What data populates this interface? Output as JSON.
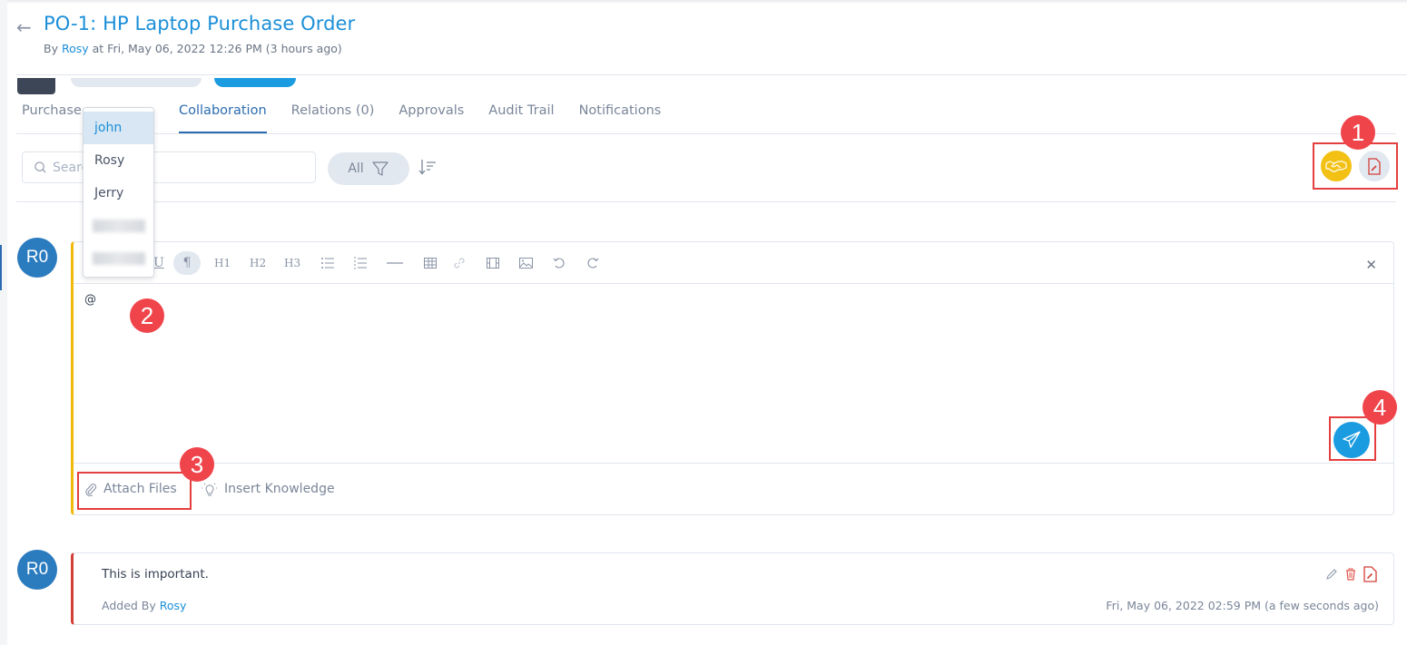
{
  "header": {
    "back_icon": "arrow-left-icon",
    "title": "PO-1: HP Laptop Purchase Order",
    "by_prefix": "By",
    "author": "Rosy",
    "created_at": "at Fri, May 06, 2022 12:26 PM (3 hours ago)"
  },
  "tabs": [
    {
      "label": "Purchase",
      "active": false
    },
    {
      "label": "Collaboration",
      "active": true
    },
    {
      "label": "Relations (0)",
      "active": false
    },
    {
      "label": "Approvals",
      "active": false
    },
    {
      "label": "Audit Trail",
      "active": false
    },
    {
      "label": "Notifications",
      "active": false
    }
  ],
  "toolbar": {
    "search_placeholder": "Search",
    "filter_label": "All",
    "filter_icon": "funnel-icon",
    "sort_icon": "sort-icon",
    "handshake_icon": "handshake-icon",
    "pdf_icon": "pdf-export-icon"
  },
  "mention_dropdown": {
    "items": [
      "john",
      "Rosy",
      "Jerry",
      "[blurred]",
      "[blurred]"
    ],
    "selected": "john"
  },
  "editor": {
    "avatar_initials": "R0",
    "toolbar_items": [
      "underline",
      "paragraph",
      "H1",
      "H2",
      "H3",
      "bullet-list",
      "numbered-list",
      "horizontal-rule",
      "table",
      "link",
      "video",
      "image",
      "undo",
      "redo"
    ],
    "h1": "H1",
    "h2": "H2",
    "h3": "H3",
    "content": "@",
    "attach_label": "Attach Files",
    "insert_knowledge_label": "Insert Knowledge",
    "accent_color": "#f2b90d"
  },
  "annotations": [
    "1",
    "2",
    "3",
    "4"
  ],
  "notes": [
    {
      "avatar_initials": "R0",
      "text": "This is important.",
      "added_by_prefix": "Added By",
      "added_by": "Rosy",
      "timestamp": "Fri, May 06, 2022 02:59 PM (a few seconds ago)",
      "accent_color": "#d23f37"
    }
  ]
}
